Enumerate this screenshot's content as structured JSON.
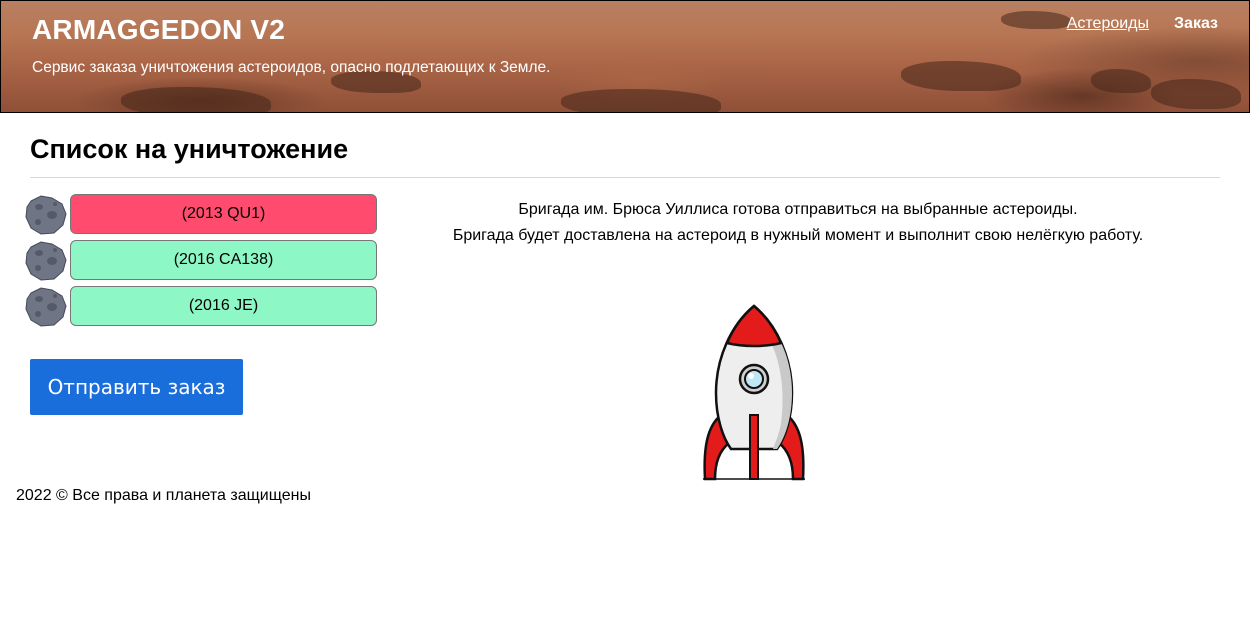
{
  "header": {
    "title": "ARMAGGEDON V2",
    "subtitle": "Сервис заказа уничтожения астероидов, опасно подлетающих к Земле.",
    "nav": [
      {
        "label": "Астероиды",
        "active": false
      },
      {
        "label": "Заказ",
        "active": true
      }
    ]
  },
  "main": {
    "heading": "Список на уничтожение",
    "asteroids": [
      {
        "name": "(2013 QU1)",
        "status": "dangerous",
        "color": "#ff4c6e"
      },
      {
        "name": "(2016 CA138)",
        "status": "safe",
        "color": "#8ef7c6"
      },
      {
        "name": "(2016 JE)",
        "status": "safe",
        "color": "#8ef7c6"
      }
    ],
    "submit_label": "Отправить заказ",
    "info_lines": [
      "Бригада им. Брюса Уиллиса готова отправиться на выбранные астероиды.",
      "Бригада будет доставлена на астероид в нужный момент и выполнит свою нелёгкую работу."
    ]
  },
  "footer": {
    "text": "2022 © Все права и планета защищены"
  },
  "colors": {
    "accent": "#1a6edc",
    "danger": "#ff4c6e",
    "safe": "#8ef7c6"
  },
  "icons": [
    "asteroid-icon",
    "rocket-icon"
  ]
}
